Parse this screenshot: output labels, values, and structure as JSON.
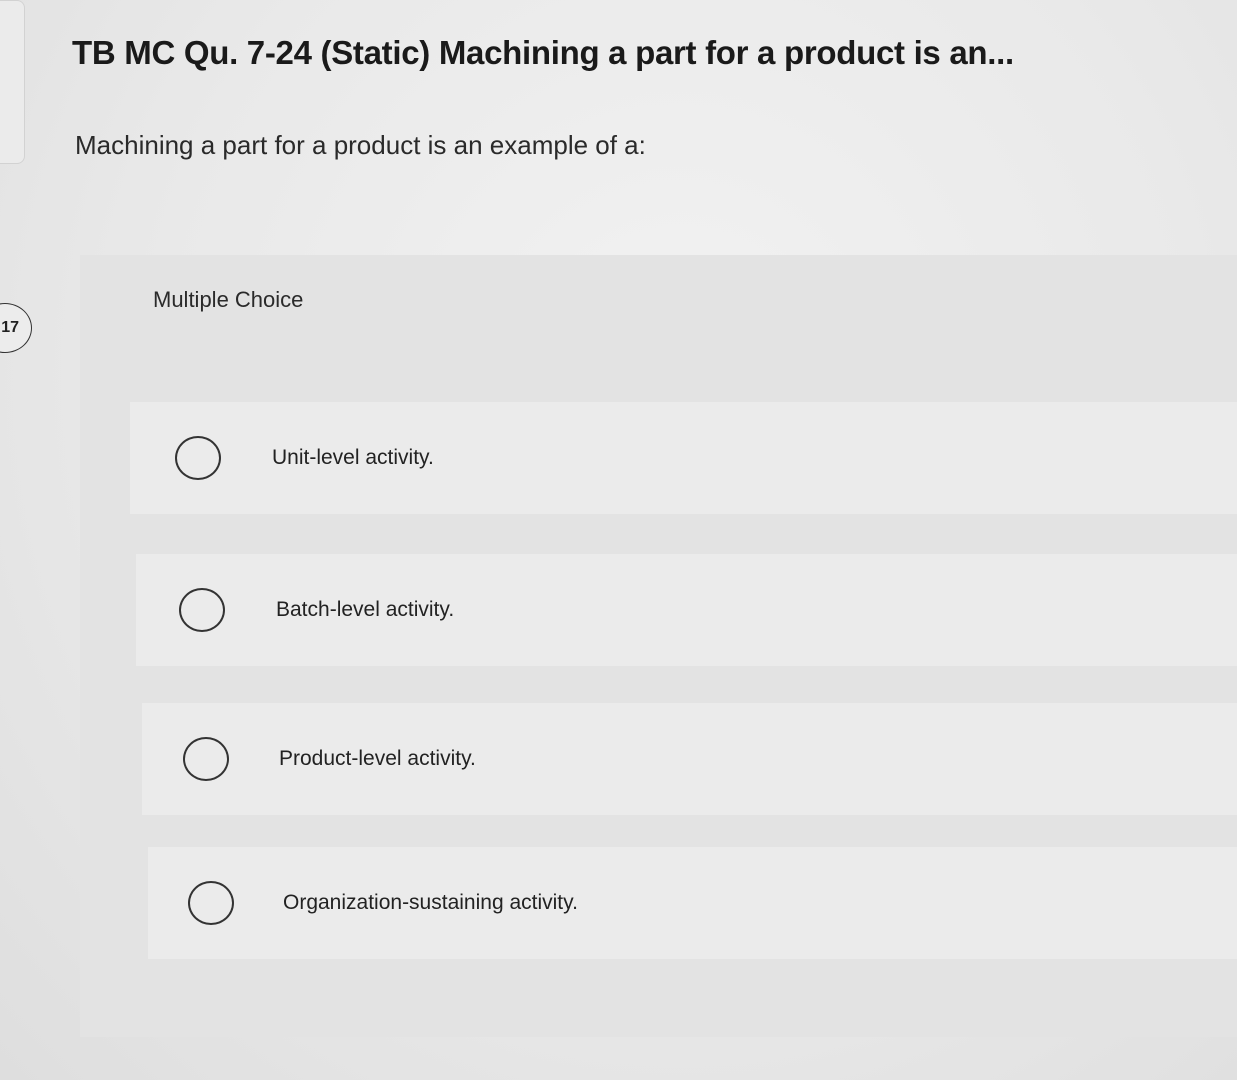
{
  "question_number": "17",
  "title": "TB MC Qu. 7-24 (Static) Machining a part for a product is an...",
  "question_text": "Machining a part for a product is an example of a:",
  "answer_section": {
    "label": "Multiple Choice",
    "options": [
      {
        "label": "Unit-level activity.",
        "selected": false
      },
      {
        "label": "Batch-level activity.",
        "selected": false
      },
      {
        "label": "Product-level activity.",
        "selected": false
      },
      {
        "label": "Organization-sustaining activity.",
        "selected": false
      }
    ]
  }
}
